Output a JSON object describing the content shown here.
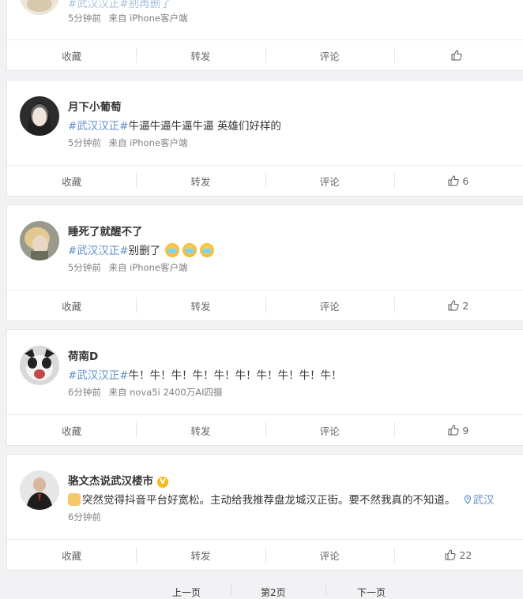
{
  "actions": {
    "fav": "收藏",
    "repost": "转发",
    "comment": "评论"
  },
  "posts": [
    {
      "name": "",
      "topic": "#武汉汉正#",
      "text": "别再删了",
      "time": "5分钟前",
      "source": "来自 iPhone客户端",
      "likes": ""
    },
    {
      "name": "月下小葡萄",
      "topic": "#武汉汉正#",
      "text": "牛逼牛逼牛逼牛逼 英雄们好样的",
      "time": "5分钟前",
      "source": "来自 iPhone客户端",
      "likes": "6"
    },
    {
      "name": "睡死了就醒不了",
      "topic": "#武汉汉正#",
      "text": "别删了",
      "time": "5分钟前",
      "source": "来自 iPhone客户端",
      "likes": "2"
    },
    {
      "name": "荷南D",
      "topic": "#武汉汉正#",
      "text": "牛！牛！牛！牛！牛！牛！牛！牛！牛！牛！",
      "time": "6分钟前",
      "source": "来自 nova5i 2400万AI四摄",
      "likes": "9"
    },
    {
      "name": "骆文杰说武汉楼市",
      "topic": "",
      "text": "突然觉得抖音平台好宽松。主动给我推荐盘龙城汉正街。要不然我真的不知道。",
      "location": "武汉",
      "time": "6分钟前",
      "source": "",
      "likes": "22"
    }
  ],
  "pager": {
    "prev": "上一页",
    "current": "第2页",
    "next": "下一页"
  },
  "colors": {
    "topic": "#5d8ec8",
    "background": "#f2f2f5"
  }
}
